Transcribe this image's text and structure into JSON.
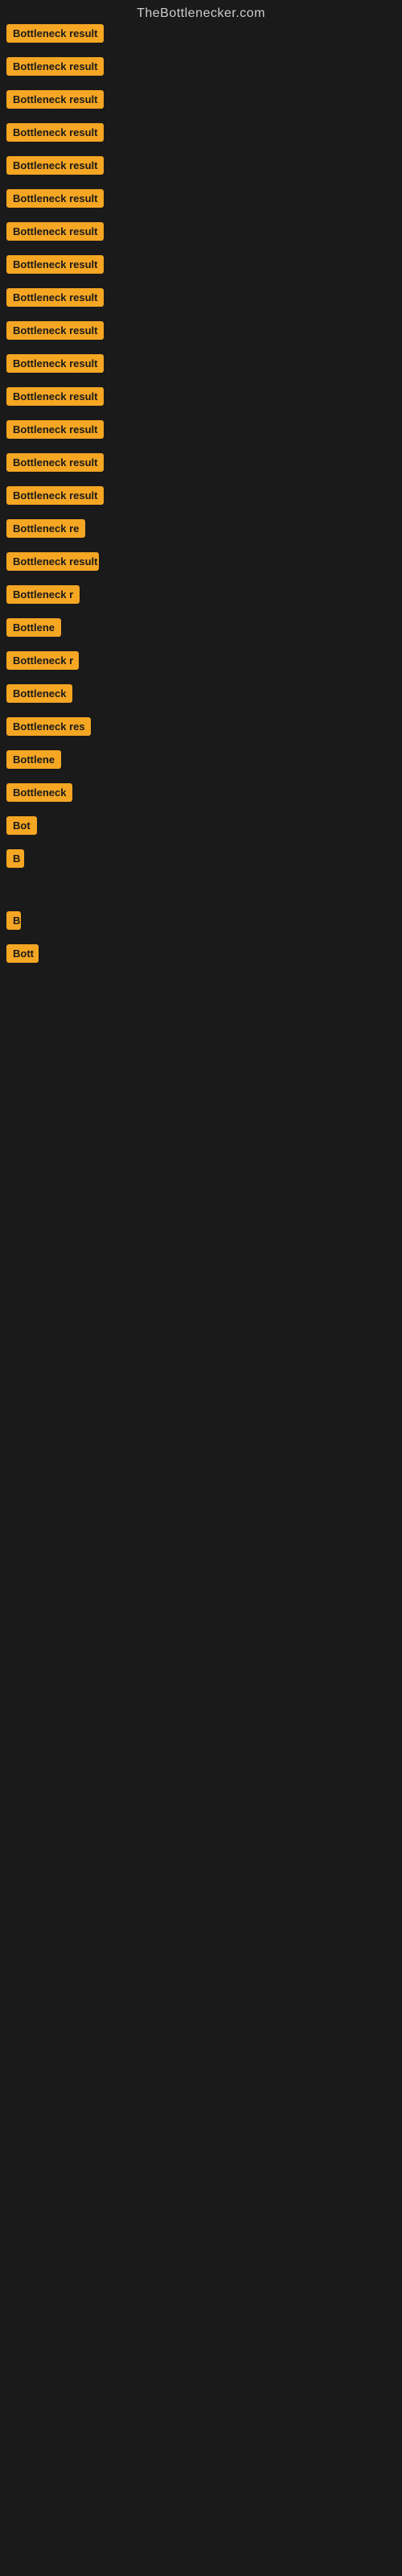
{
  "site": {
    "title": "TheBottlenecker.com"
  },
  "items": [
    {
      "label": "Bottleneck result",
      "width": 140
    },
    {
      "label": "Bottleneck result",
      "width": 140
    },
    {
      "label": "Bottleneck result",
      "width": 140
    },
    {
      "label": "Bottleneck result",
      "width": 140
    },
    {
      "label": "Bottleneck result",
      "width": 140
    },
    {
      "label": "Bottleneck result",
      "width": 140
    },
    {
      "label": "Bottleneck result",
      "width": 140
    },
    {
      "label": "Bottleneck result",
      "width": 140
    },
    {
      "label": "Bottleneck result",
      "width": 140
    },
    {
      "label": "Bottleneck result",
      "width": 140
    },
    {
      "label": "Bottleneck result",
      "width": 140
    },
    {
      "label": "Bottleneck result",
      "width": 140
    },
    {
      "label": "Bottleneck result",
      "width": 130
    },
    {
      "label": "Bottleneck result",
      "width": 130
    },
    {
      "label": "Bottleneck result",
      "width": 125
    },
    {
      "label": "Bottleneck re",
      "width": 105
    },
    {
      "label": "Bottleneck result",
      "width": 115
    },
    {
      "label": "Bottleneck r",
      "width": 95
    },
    {
      "label": "Bottlene",
      "width": 78
    },
    {
      "label": "Bottleneck r",
      "width": 90
    },
    {
      "label": "Bottleneck",
      "width": 85
    },
    {
      "label": "Bottleneck res",
      "width": 105
    },
    {
      "label": "Bottlene",
      "width": 75
    },
    {
      "label": "Bottleneck",
      "width": 82
    },
    {
      "label": "Bot",
      "width": 40
    },
    {
      "label": "B",
      "width": 22
    },
    {
      "label": "",
      "width": 0
    },
    {
      "label": "",
      "width": 0
    },
    {
      "label": "B",
      "width": 18
    },
    {
      "label": "Bott",
      "width": 40
    },
    {
      "label": "",
      "width": 0
    },
    {
      "label": "",
      "width": 0
    },
    {
      "label": "",
      "width": 0
    },
    {
      "label": "",
      "width": 0
    },
    {
      "label": "",
      "width": 0
    }
  ]
}
